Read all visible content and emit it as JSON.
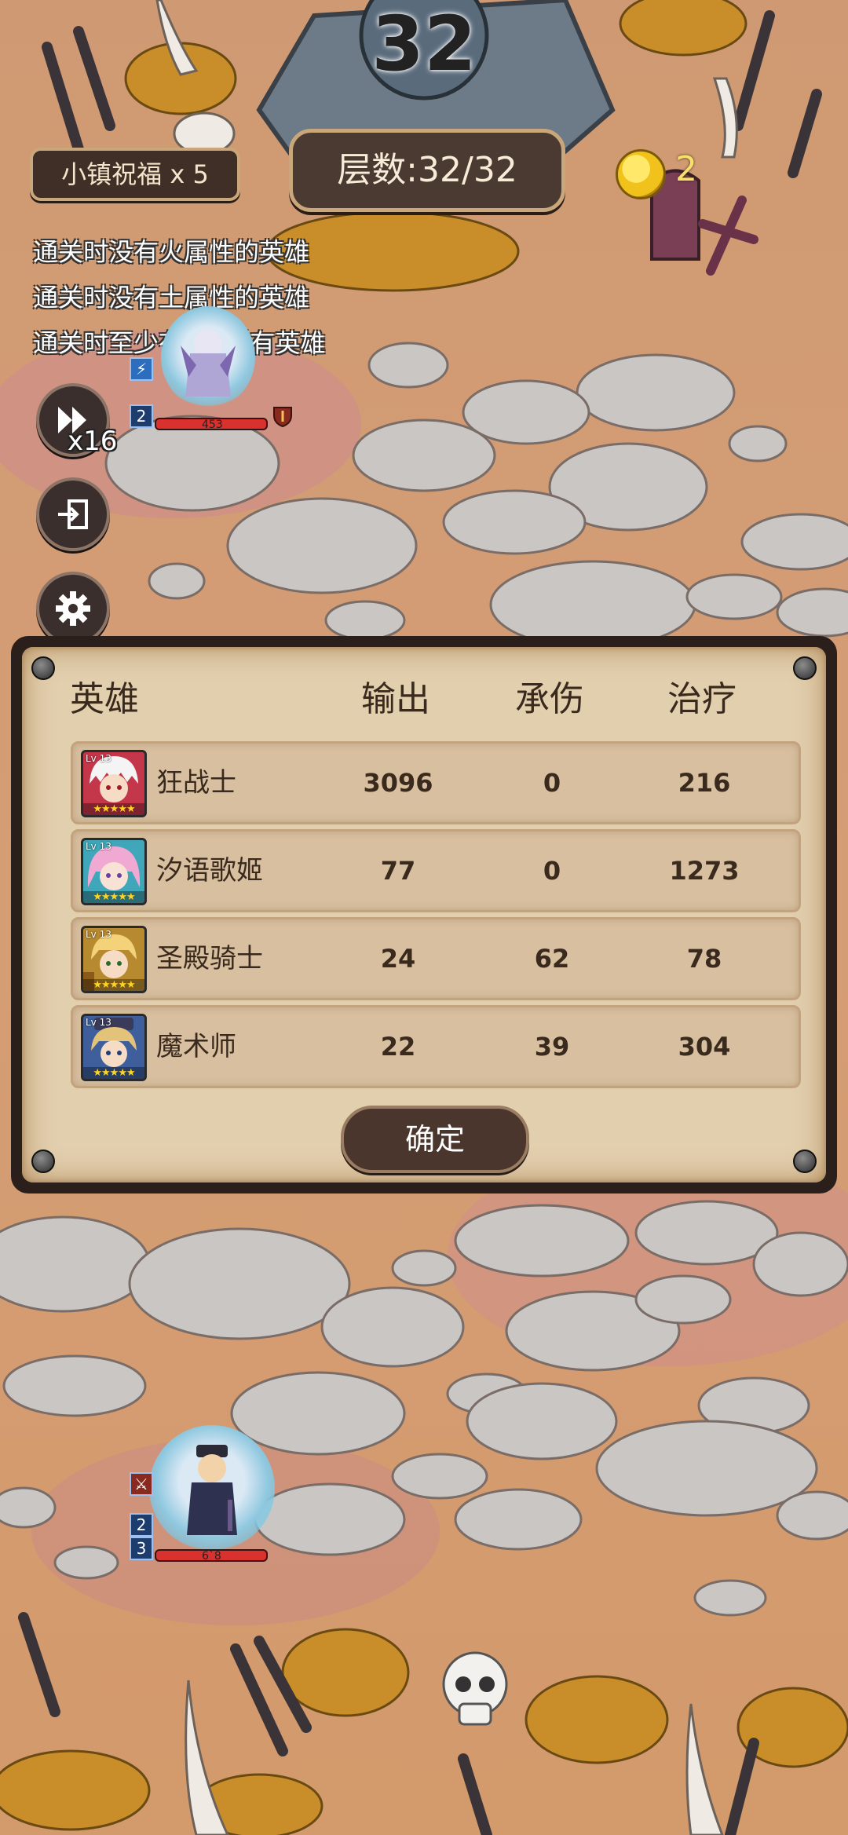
{
  "hud": {
    "wave_number": "32",
    "blessing_label": "小镇祝福 x 5",
    "floor_label": "层数:32/32",
    "coin_count": "2",
    "coin_icon": "gold-coin-icon"
  },
  "conditions": [
    "通关时没有火属性的英雄",
    "通关时没有土属性的英雄",
    "通关时至少有4名稀有英雄"
  ],
  "controls": {
    "speed_label": "x16",
    "speed_icon": "fast-forward-icon",
    "exit_icon": "exit-door-icon",
    "settings_icon": "gear-icon"
  },
  "units": [
    {
      "hp_text": "453",
      "badge": "2",
      "icon": "shield-sword-icon"
    },
    {
      "hp_text": "6`8",
      "badge_top": "2",
      "badge_bottom": "3"
    }
  ],
  "result": {
    "headers": {
      "hero": "英雄",
      "damage": "输出",
      "tank": "承伤",
      "heal": "治疗"
    },
    "rows": [
      {
        "name": "狂战士",
        "damage": "3096",
        "tank": "0",
        "heal": "216",
        "portrait_bg": "#c4374a",
        "hair": "#f4f4f4",
        "lv": "Lv 13"
      },
      {
        "name": "汐语歌姬",
        "damage": "77",
        "tank": "0",
        "heal": "1273",
        "portrait_bg": "#3fa7b9",
        "hair": "#f0a9d2",
        "lv": "Lv 13"
      },
      {
        "name": "圣殿骑士",
        "damage": "24",
        "tank": "62",
        "heal": "78",
        "portrait_bg": "#b88a2f",
        "hair": "#f3d27a",
        "lv": "Lv 13"
      },
      {
        "name": "魔术师",
        "damage": "22",
        "tank": "39",
        "heal": "304",
        "portrait_bg": "#3e5e9c",
        "hair": "#e3c27a",
        "lv": "Lv 13"
      }
    ],
    "stars": "★★★★★",
    "confirm_label": "确定"
  }
}
